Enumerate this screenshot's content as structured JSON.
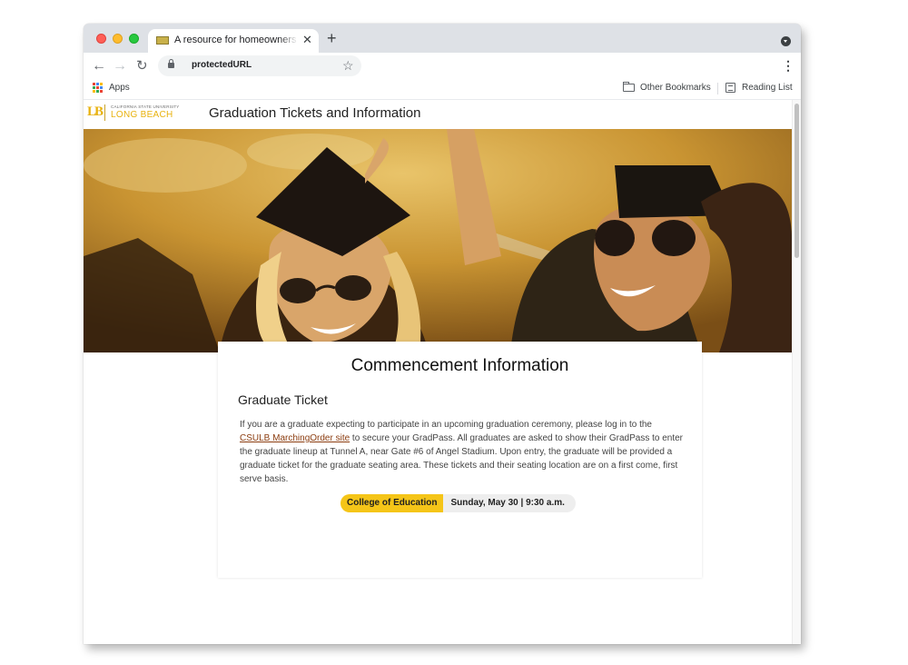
{
  "tab": {
    "title": "A resource for homeowners that"
  },
  "omnibox": {
    "url": "protectedURL"
  },
  "bookmarks": {
    "apps_label": "Apps",
    "other_label": "Other Bookmarks",
    "reading_label": "Reading List"
  },
  "icons": {
    "favicon": "site-favicon",
    "close": "close-icon",
    "new_tab": "plus-icon",
    "profile": "chevron-down-circle-icon",
    "back": "arrow-left-icon",
    "forward": "arrow-right-icon",
    "reload": "reload-icon",
    "lock": "lock-icon",
    "star": "star-icon",
    "menu": "more-vertical-icon",
    "apps": "apps-grid-icon",
    "folder": "folder-icon",
    "reading": "reading-list-icon"
  },
  "site": {
    "logo_mark": "LB",
    "logo_small": "CALIFORNIA STATE UNIVERSITY",
    "logo_big": "LONG BEACH",
    "title": "Graduation Tickets and Information"
  },
  "hero": {
    "description": "graduates in caps and sunglasses celebrating"
  },
  "card": {
    "title": "Commencement Information",
    "section_title": "Graduate Ticket",
    "body_before": "If you are a graduate expecting to participate in an upcoming graduation ceremony, please log in to the ",
    "link_text": "CSULB MarchingOrder site",
    "body_after": " to secure your GradPass. All graduates are asked to show their GradPass to enter the graduate lineup at Tunnel A, near Gate #6 of Angel Stadium. Upon entry, the graduate will be provided a graduate ticket for the graduate seating area. These tickets and their seating location are on a first come, first serve basis.",
    "college": "College of Education",
    "schedule": "Sunday, May 30  | 9:30 a.m."
  },
  "colors": {
    "brand_gold": "#e8b20e",
    "pill_gold": "#f5c518",
    "link": "#8b3c0f"
  }
}
